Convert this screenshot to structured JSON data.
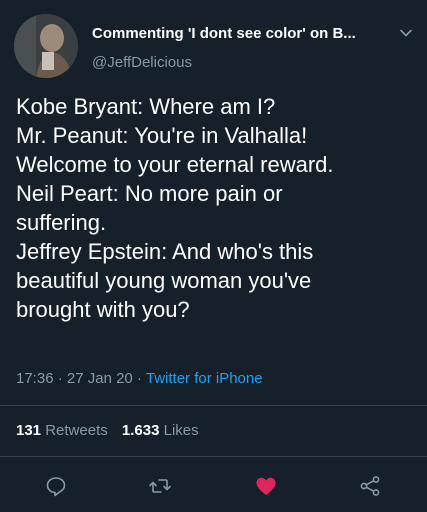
{
  "tweet": {
    "display_name": "Commenting 'I dont see color' on B...",
    "handle": "@JeffDelicious",
    "lines": [
      "Kobe Bryant: Where am I?",
      "Mr. Peanut: You're in Valhalla!",
      "Welcome to your eternal reward.",
      "Neil Peart: No more pain or",
      "suffering.",
      "Jeffrey Epstein: And who's this",
      "beautiful young woman you've",
      "brought with you?"
    ],
    "time": "17:36",
    "date": "27 Jan 20",
    "separator": "·",
    "source": "Twitter for iPhone"
  },
  "stats": {
    "retweets_count": "131",
    "retweets_label": "Retweets",
    "likes_count": "1.633",
    "likes_label": "Likes"
  },
  "actions": {
    "reply_icon": "reply-icon",
    "retweet_icon": "retweet-icon",
    "like_icon": "heart-icon",
    "share_icon": "share-icon",
    "like_color": "#e0245e",
    "muted_color": "#8899a6"
  },
  "colors": {
    "background": "#15202b",
    "text": "#ffffff",
    "secondary": "#8899a6",
    "link": "#1da1f2",
    "divider": "#38444d"
  }
}
